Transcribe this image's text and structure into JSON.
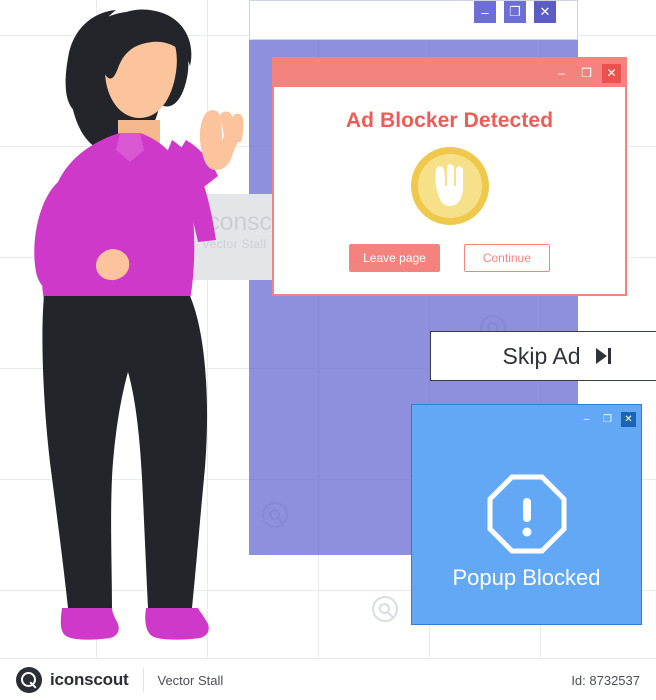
{
  "illustration": {
    "title": "Ad Blocker Detected illustration",
    "watermark": {
      "brand": "iconscout",
      "sub": "Vector Stall"
    }
  },
  "background_window": {
    "controls": [
      "minimize",
      "maximize",
      "close"
    ],
    "minimize_glyph": "–",
    "maximize_glyph": "❐",
    "close_glyph": "✕"
  },
  "ad_modal": {
    "title": "Ad Blocker Detected",
    "icon": "raised-hand-icon",
    "controls": {
      "minimize_glyph": "–",
      "maximize_glyph": "❐",
      "close_glyph": "✕"
    },
    "buttons": {
      "leave": "Leave page",
      "continue": "Continue"
    }
  },
  "skip_ad": {
    "label": "Skip Ad",
    "icon": "skip-forward-icon"
  },
  "popup_window": {
    "title": "Popup Blocked",
    "icon": "warning-octagon-icon",
    "controls": {
      "minimize_glyph": "–",
      "maximize_glyph": "❐",
      "close_glyph": "✕"
    }
  },
  "footer": {
    "brand": "iconscout",
    "vendor": "Vector Stall",
    "id_label": "Id: 8732537"
  },
  "colors": {
    "accent_red": "#f4837f",
    "accent_blue": "#62a8f4",
    "purple_window": "#6e6fd4",
    "shirt_magenta": "#cf39c9",
    "pants_dark": "#23252b",
    "skin": "#f9c39b",
    "hair": "#23252b",
    "hand_circle": "#f6e089",
    "hand_circle_border": "#efc94b"
  }
}
